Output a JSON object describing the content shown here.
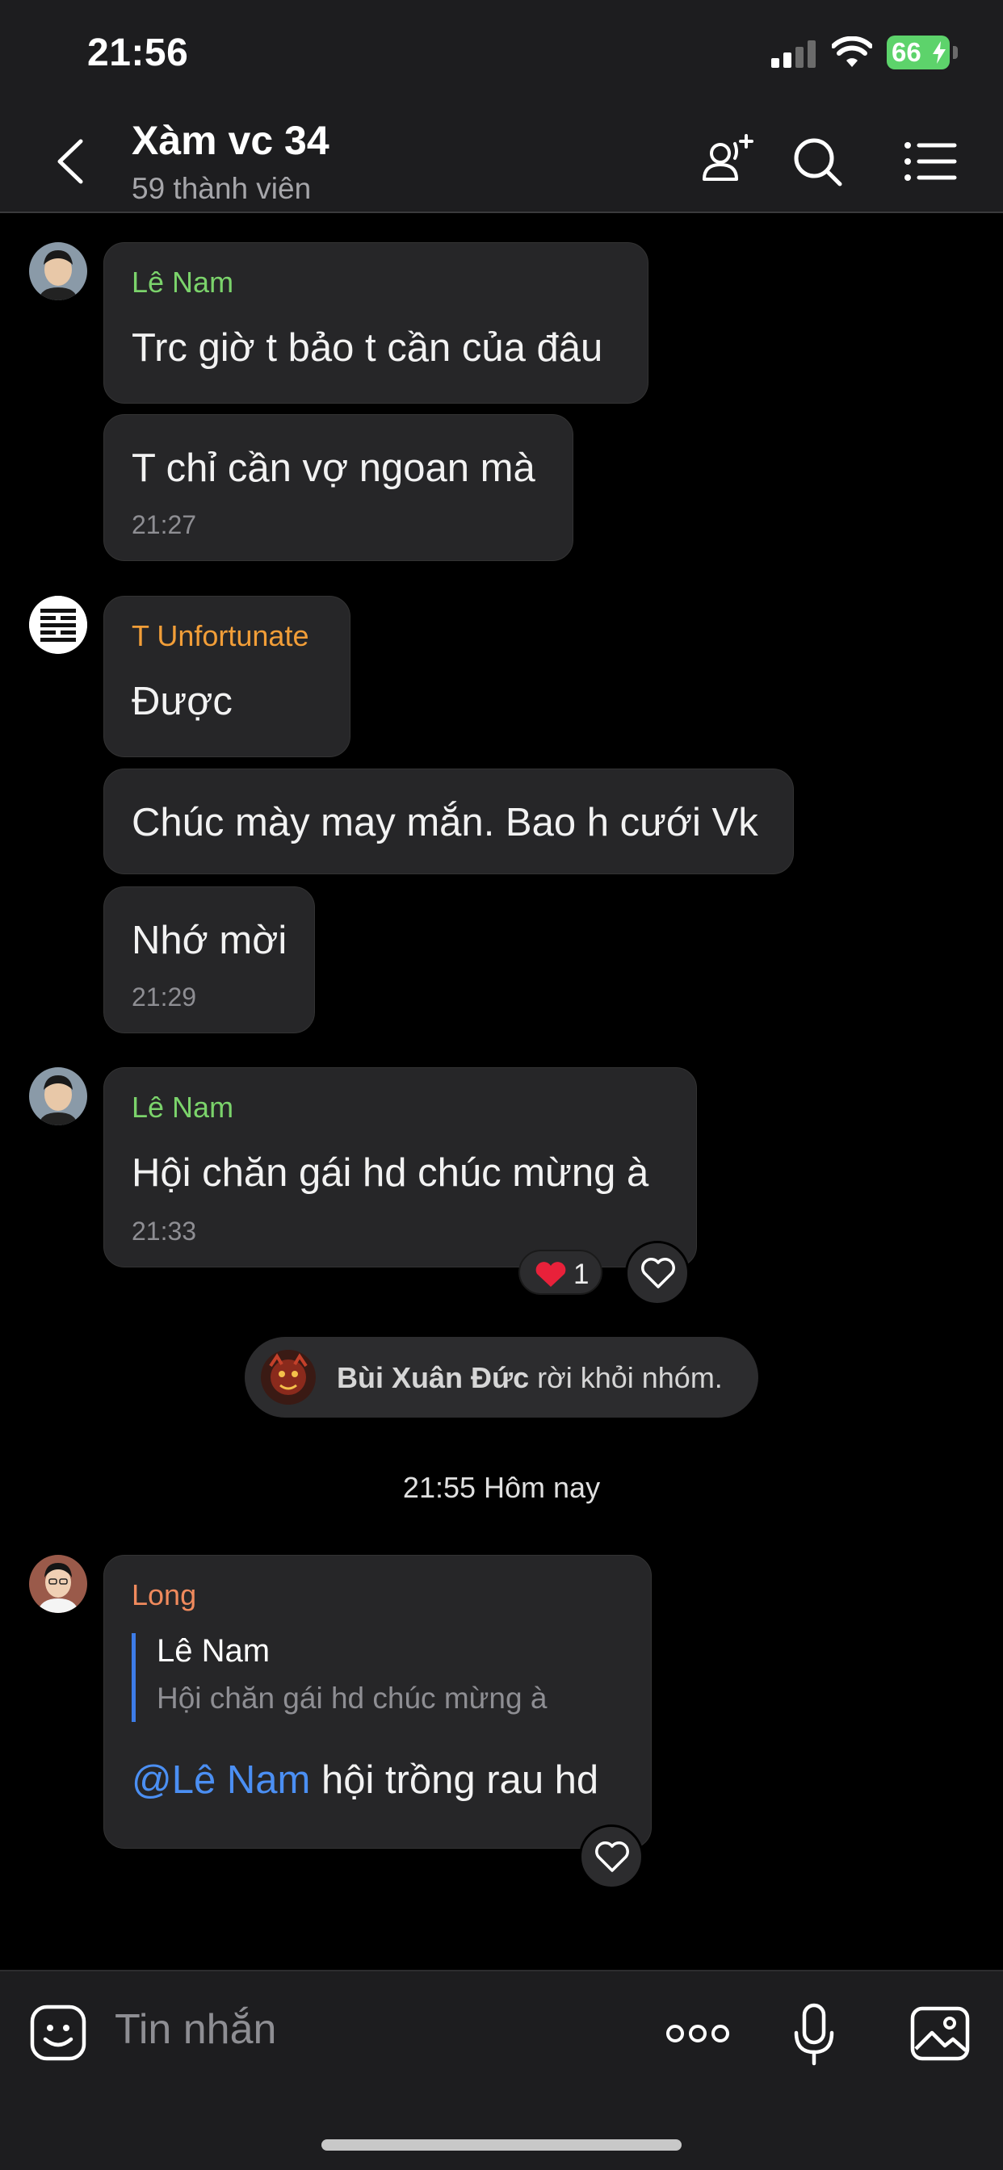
{
  "status_bar": {
    "time": "21:56",
    "battery": "66"
  },
  "header": {
    "title": "Xàm vc 34",
    "subtitle": "59 thành viên"
  },
  "colors": {
    "sender_green": "#7bd36b",
    "sender_orange": "#f29e38",
    "sender_salmon": "#f08a5d",
    "mention_blue": "#4b8ff3",
    "reaction_red": "#e8213a"
  },
  "messages": [
    {
      "sender": "Lê Nam",
      "text": "Trc giờ t bảo t cần của đâu"
    },
    {
      "text": "T chỉ cần vợ ngoan mà",
      "time": "21:27"
    },
    {
      "sender": "T Unfortunate",
      "text": "Được"
    },
    {
      "text": "Chúc mày may mắn. Bao h cưới Vk"
    },
    {
      "text": "Nhớ mời",
      "time": "21:29"
    },
    {
      "sender": "Lê Nam",
      "text": "Hội chăn gái hd chúc mừng à",
      "time": "21:33",
      "reaction_count": "1"
    },
    {
      "sender": "Long",
      "quote_name": "Lê Nam",
      "quote_text": "Hội chăn gái hd chúc mừng à",
      "mention": "@Lê Nam",
      "text": " hội trồng rau hd"
    }
  ],
  "system_event": {
    "name": "Bùi Xuân Đức",
    "text": " rời khỏi nhóm."
  },
  "date_separator": "21:55 Hôm nay",
  "input": {
    "placeholder": "Tin nhắn"
  }
}
